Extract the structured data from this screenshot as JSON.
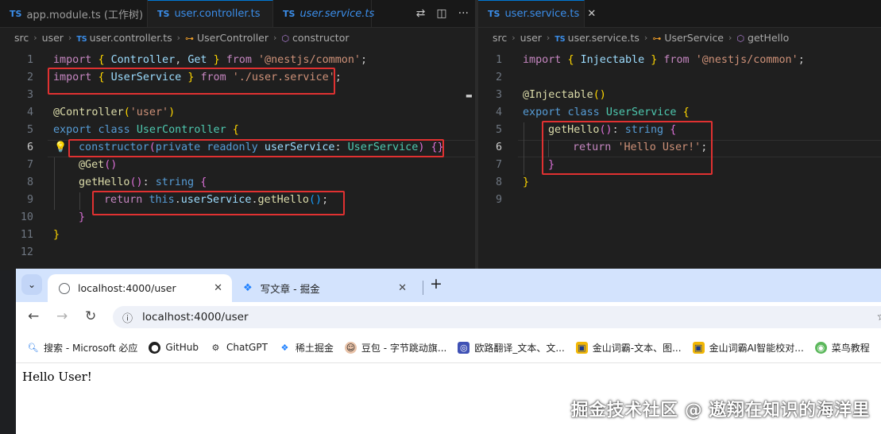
{
  "editor": {
    "left_pane": {
      "tabs": [
        {
          "label": "app.module.ts (工作树)",
          "prefix": "TS",
          "active": false
        },
        {
          "label": "user.controller.ts",
          "prefix": "TS",
          "active": true
        },
        {
          "label": "user.service.ts",
          "prefix": "TS",
          "active": false
        }
      ],
      "breadcrumb": [
        "src",
        "user",
        "user.controller.ts",
        "UserController",
        "constructor"
      ],
      "line_numbers": [
        "1",
        "2",
        "3",
        "4",
        "5",
        "6",
        "7",
        "8",
        "9",
        "10",
        "11",
        "12"
      ],
      "current_line": "6",
      "lines": [
        "import { Controller, Get } from '@nestjs/common';",
        "import { UserService } from './user.service';",
        "",
        "@Controller('user')",
        "export class UserController {",
        "  constructor(private readonly userService: UserService) {}",
        "  @Get()",
        "  getHello(): string {",
        "    return this.userService.getHello();",
        "  }",
        "}",
        ""
      ]
    },
    "right_pane": {
      "tabs": [
        {
          "label": "user.service.ts",
          "prefix": "TS",
          "active": true
        }
      ],
      "breadcrumb": [
        "src",
        "user",
        "user.service.ts",
        "UserService",
        "getHello"
      ],
      "line_numbers": [
        "1",
        "2",
        "3",
        "4",
        "5",
        "6",
        "7",
        "8",
        "9"
      ],
      "current_line": "6",
      "lines": [
        "import { Injectable } from '@nestjs/common';",
        "",
        "@Injectable()",
        "export class UserService {",
        "  getHello(): string {",
        "    return 'Hello User!';",
        "  }",
        "}",
        ""
      ]
    },
    "icons": [
      "compare-changes-icon",
      "split-editor-icon",
      "more-actions-icon",
      "lightbulb-icon"
    ]
  },
  "browser": {
    "tabs": [
      {
        "title": "localhost:4000/user",
        "active": true,
        "icon": "globe-icon"
      },
      {
        "title": "写文章 - 掘金",
        "active": false,
        "icon": "juejin-icon"
      }
    ],
    "address": "localhost:4000/user",
    "bookmarks": [
      {
        "label": "搜索 - Microsoft 必应",
        "icon": "search-icon",
        "color": "#1a73e8"
      },
      {
        "label": "GitHub",
        "icon": "github-icon",
        "color": "#1f1f1f"
      },
      {
        "label": "ChatGPT",
        "icon": "chatgpt-icon",
        "color": "#333333"
      },
      {
        "label": "稀土掘金",
        "icon": "juejin-icon",
        "color": "#1e80ff"
      },
      {
        "label": "豆包 - 字节跳动旗...",
        "icon": "doubao-icon",
        "color": "#d9825b"
      },
      {
        "label": "欧路翻译_文本、文...",
        "icon": "eudic-icon",
        "color": "#3f51b5"
      },
      {
        "label": "金山词霸-文本、图...",
        "icon": "iciba-icon",
        "color": "#f2b705"
      },
      {
        "label": "金山词霸AI智能校对...",
        "icon": "iciba-icon",
        "color": "#f2b705"
      },
      {
        "label": "菜鸟教程",
        "icon": "runoob-icon",
        "color": "#5cb85c"
      }
    ],
    "page_content": "Hello User!"
  },
  "watermark": "掘金技术社区 @ 遨翔在知识的海洋里"
}
